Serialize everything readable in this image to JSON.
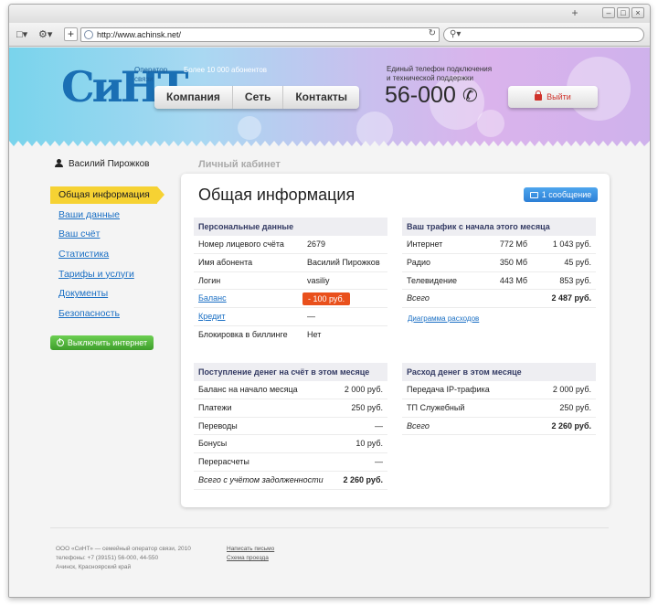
{
  "browser": {
    "url": "http://www.achinsk.net/",
    "plus_label": "+",
    "win_min": "–",
    "win_max": "□",
    "win_close": "×"
  },
  "header": {
    "logo": "СиНТ",
    "operator_line1": "Оператор",
    "operator_line2": "связи",
    "subscribers": "Более 10 000 абонентов",
    "nav": [
      "Компания",
      "Сеть",
      "Контакты"
    ],
    "phone_label_line1": "Единый телефон подключения",
    "phone_label_line2": "и технической поддержки",
    "phone": "56-000",
    "logout": "Выйти"
  },
  "user": {
    "name": "Василий Пирожков"
  },
  "breadcrumb": "Личный кабинет",
  "sidebar": {
    "items": [
      {
        "label": "Общая информация"
      },
      {
        "label": "Ваши данные"
      },
      {
        "label": "Ваш счёт"
      },
      {
        "label": "Статистика"
      },
      {
        "label": "Тарифы и услуги"
      },
      {
        "label": "Документы"
      },
      {
        "label": "Безопасность"
      }
    ],
    "disable_button": "Выключить интернет"
  },
  "main": {
    "title": "Общая информация",
    "messages_button": "1 сообщение",
    "personal": {
      "header": "Персональные данные",
      "rows": [
        {
          "label": "Номер лицевого счёта",
          "value": "2679"
        },
        {
          "label": "Имя абонента",
          "value": "Василий Пирожков"
        },
        {
          "label": "Логин",
          "value": "vasiliy"
        },
        {
          "label": "Баланс",
          "value": "- 100 руб."
        },
        {
          "label": "Кредит",
          "value": "—"
        },
        {
          "label": "Блокировка в биллинге",
          "value": "Нет"
        }
      ]
    },
    "traffic": {
      "header": "Ваш трафик с начала этого месяца",
      "rows": [
        {
          "label": "Интернет",
          "mb": "772 Мб",
          "cost": "1 043 руб."
        },
        {
          "label": "Радио",
          "mb": "350 Мб",
          "cost": "45 руб."
        },
        {
          "label": "Телевидение",
          "mb": "443 Мб",
          "cost": "853 руб."
        },
        {
          "label": "Всего",
          "mb": "",
          "cost": "2 487 руб."
        }
      ],
      "chart_link": "Диаграмма расходов"
    },
    "income": {
      "header": "Поступление денег на счёт в этом месяце",
      "rows": [
        {
          "label": "Баланс на начало месяца",
          "value": "2 000 руб."
        },
        {
          "label": "Платежи",
          "value": "250 руб."
        },
        {
          "label": "Переводы",
          "value": "—"
        },
        {
          "label": "Бонусы",
          "value": "10 руб."
        },
        {
          "label": "Перерасчеты",
          "value": "—"
        },
        {
          "label": "Всего с учётом задолженности",
          "value": "2 260 руб."
        }
      ]
    },
    "expense": {
      "header": "Расход денег в этом месяце",
      "rows": [
        {
          "label": "Передача IP-трафика",
          "value": "2 000 руб."
        },
        {
          "label": "ТП Служебный",
          "value": "250 руб."
        },
        {
          "label": "Всего",
          "value": "2 260 руб."
        }
      ]
    }
  },
  "footer": {
    "line1": "ООО «СиНТ» — семейный оператор связи, 2010",
    "line2": "телефоны: +7 (39151) 56-000, 44-550",
    "line3": "Ачинск, Красноярский край",
    "link1": "Написать письмо",
    "link2": "Схема проезда"
  }
}
